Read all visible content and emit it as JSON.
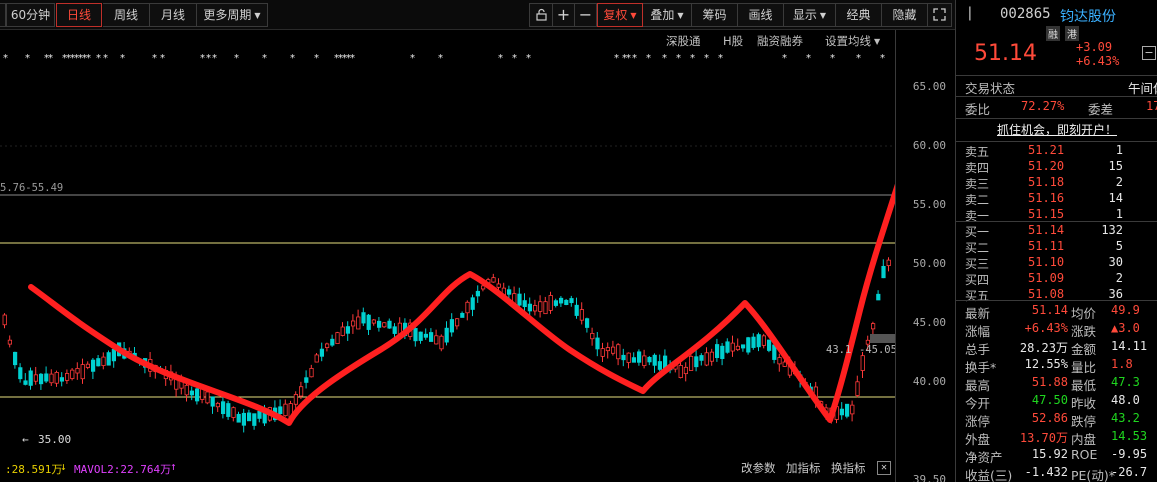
{
  "toolbar": {
    "min60": "60分钟",
    "daily": "日线",
    "weekly": "周线",
    "monthly": "月线",
    "more_periods": "更多周期",
    "fuquan": "复权",
    "overlay": "叠加",
    "chips": "筹码",
    "draw_line": "画线",
    "display": "显示",
    "classic": "经典",
    "hide": "隐藏"
  },
  "subbar": {
    "sgt": "深股通",
    "h_share": "H股",
    "margin": "融资融券",
    "set_ma": "设置均线"
  },
  "chart": {
    "y_ticks": [
      "65.00",
      "60.00",
      "55.00",
      "50.00",
      "45.00",
      "40.00",
      "39.50"
    ],
    "range_label": "5.76-55.49",
    "low_label": "35.00",
    "mid_label": "43.1",
    "mid_label2": "-45.05",
    "colors": {
      "up": "#ff3a3a",
      "down": "#00d0d0",
      "hline": "#e8e080",
      "trend": "#ff2020"
    }
  },
  "legend": {
    "vol": ":28.591万",
    "mavol2": "MAVOL2:22.764万",
    "edit_params": "改参数",
    "add_indicator": "加指标",
    "switch_indicator": "换指标",
    "close": "✕"
  },
  "stock": {
    "code": "002865",
    "name": "钧达股份",
    "tag1": "融",
    "tag2": "港",
    "price": "51.14",
    "change": "+3.09",
    "change_pct": "+6.43%"
  },
  "trade_status": {
    "label": "交易状态",
    "value": "午间休"
  },
  "ratio": {
    "label1": "委比",
    "value1": "72.27%",
    "label2": "委差",
    "value2": "17"
  },
  "promo": "抓住机会，即刻开户！",
  "orderbook": {
    "asks": [
      {
        "label": "卖五",
        "price": "51.21",
        "vol": "1"
      },
      {
        "label": "卖四",
        "price": "51.20",
        "vol": "15"
      },
      {
        "label": "卖三",
        "price": "51.18",
        "vol": "2"
      },
      {
        "label": "卖二",
        "price": "51.16",
        "vol": "14"
      },
      {
        "label": "卖一",
        "price": "51.15",
        "vol": "1"
      }
    ],
    "bids": [
      {
        "label": "买一",
        "price": "51.14",
        "vol": "132"
      },
      {
        "label": "买二",
        "price": "51.11",
        "vol": "5"
      },
      {
        "label": "买三",
        "price": "51.10",
        "vol": "30"
      },
      {
        "label": "买四",
        "price": "51.09",
        "vol": "2"
      },
      {
        "label": "买五",
        "price": "51.08",
        "vol": "36"
      }
    ]
  },
  "stats": [
    {
      "l1": "最新",
      "v1": "51.14",
      "c1": "red",
      "l2": "均价",
      "v2": "49.9",
      "c2": "red"
    },
    {
      "l1": "涨幅",
      "v1": "+6.43%",
      "c1": "red",
      "l2": "涨跌",
      "v2": "▲3.0",
      "c2": "red"
    },
    {
      "l1": "总手",
      "v1": "28.23万",
      "c1": "white",
      "l2": "金额",
      "v2": "14.11",
      "c2": "white"
    },
    {
      "l1": "换手*",
      "v1": "12.55%",
      "c1": "white",
      "l2": "量比",
      "v2": "1.8",
      "c2": "red"
    },
    {
      "l1": "最高",
      "v1": "51.88",
      "c1": "red",
      "l2": "最低",
      "v2": "47.3",
      "c2": "green"
    },
    {
      "l1": "今开",
      "v1": "47.50",
      "c1": "green",
      "l2": "昨收",
      "v2": "48.0",
      "c2": "white"
    },
    {
      "l1": "涨停",
      "v1": "52.86",
      "c1": "red",
      "l2": "跌停",
      "v2": "43.2",
      "c2": "green"
    },
    {
      "l1": "外盘",
      "v1": "13.70万",
      "c1": "red",
      "l2": "内盘",
      "v2": "14.53",
      "c2": "green"
    },
    {
      "l1": "净资产",
      "v1": "15.92",
      "c1": "white",
      "l2": "ROE",
      "v2": "-9.95",
      "c2": "white"
    },
    {
      "l1": "收益(三)",
      "v1": "-1.432",
      "c1": "white",
      "l2": "PE(动)*",
      "v2": "-26.7",
      "c2": "white"
    }
  ]
}
